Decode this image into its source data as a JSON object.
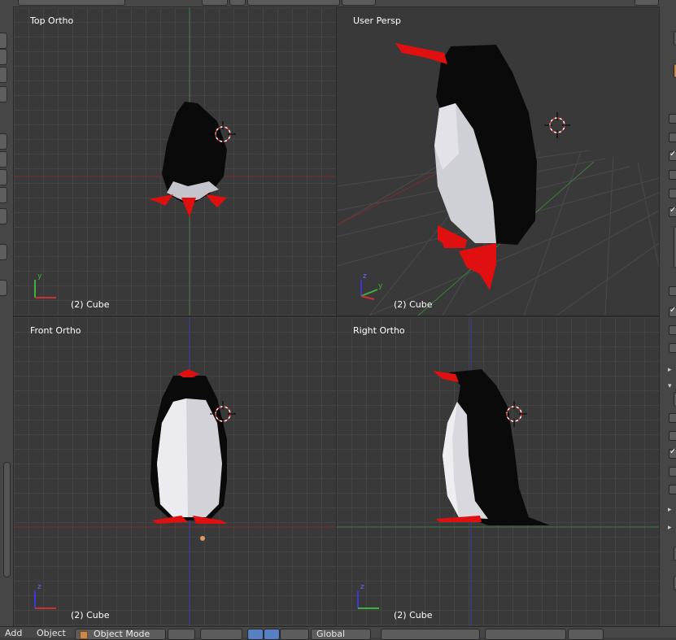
{
  "viewports": {
    "top_left": {
      "title": "Top Ortho",
      "object": "(2) Cube"
    },
    "top_right": {
      "title": "User Persp",
      "object": "(2) Cube"
    },
    "bottom_left": {
      "title": "Front Ortho",
      "object": "(2) Cube"
    },
    "bottom_right": {
      "title": "Right Ortho",
      "object": "(2) Cube"
    }
  },
  "bottom_bar": {
    "add_menu": "Add",
    "object_menu": "Object",
    "mode": "Object Mode",
    "orientation": "Global"
  },
  "colors": {
    "viewport_bg": "#393939",
    "grid": "#444444",
    "x_axis": "#9b2a2a",
    "y_axis": "#3f8f3f",
    "z_axis": "#3a3aa0",
    "penguin_body": "#0a0a0a",
    "penguin_belly": "#d8d8e0",
    "penguin_beak_feet": "#e01010"
  },
  "icons": [
    "cursor-3d-icon",
    "axis-gizmo-icon",
    "cube-icon",
    "checkbox-icon",
    "arrow-icon"
  ]
}
